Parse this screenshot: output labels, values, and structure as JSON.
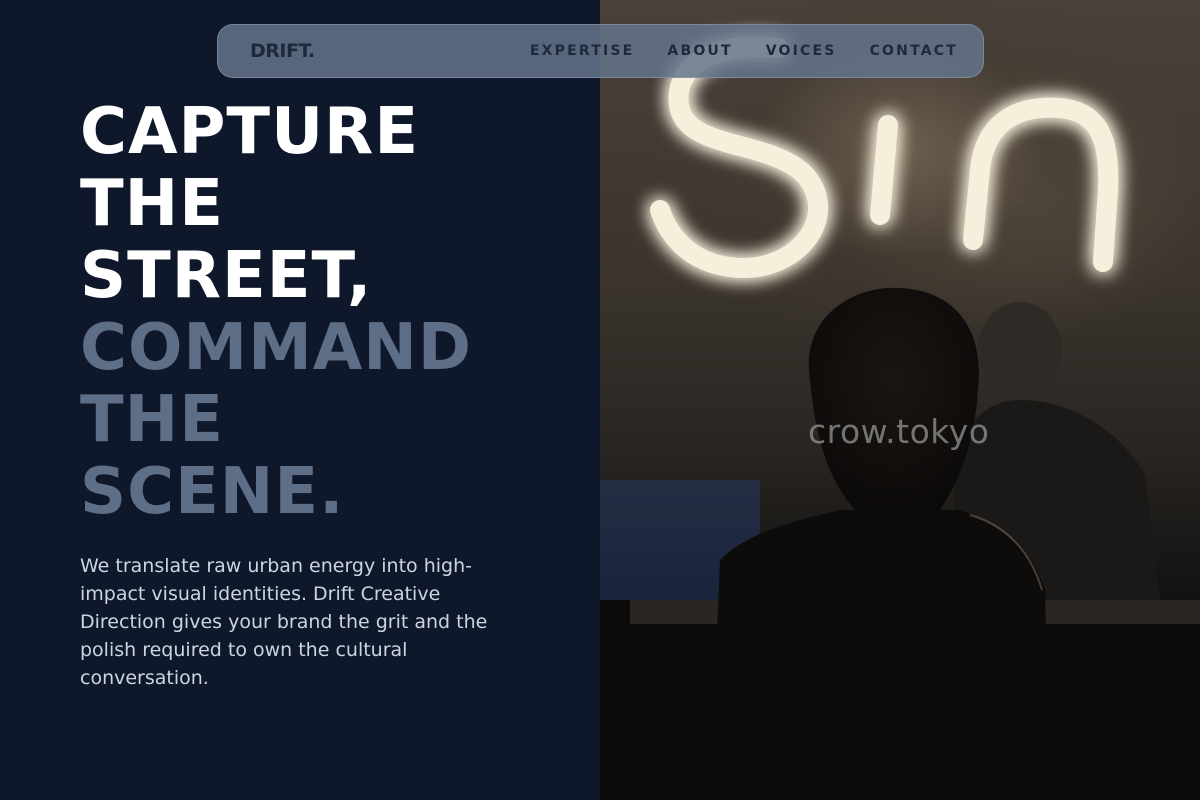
{
  "nav": {
    "logo": "DRIFT.",
    "links": [
      "EXPERTISE",
      "ABOUT",
      "VOICES",
      "CONTACT"
    ]
  },
  "hero": {
    "title_lines_primary": [
      "CAPTURE",
      "THE",
      "STREET,"
    ],
    "title_lines_secondary": [
      "COMMAND",
      "THE",
      "SCENE."
    ],
    "body": "We translate raw urban energy into high-impact visual identities. Drift Creative Direction gives your brand the grit and the polish required to own the cultural conversation."
  },
  "photo": {
    "credit": "crow.tokyo"
  },
  "colors": {
    "background": "#0f172b",
    "title_primary": "#ffffff",
    "title_secondary": "#5e6e87",
    "body_text": "#cbd5e1",
    "nav_bg": "#64748b",
    "nav_text": "#1e293b",
    "neon": "#f4eedc"
  }
}
